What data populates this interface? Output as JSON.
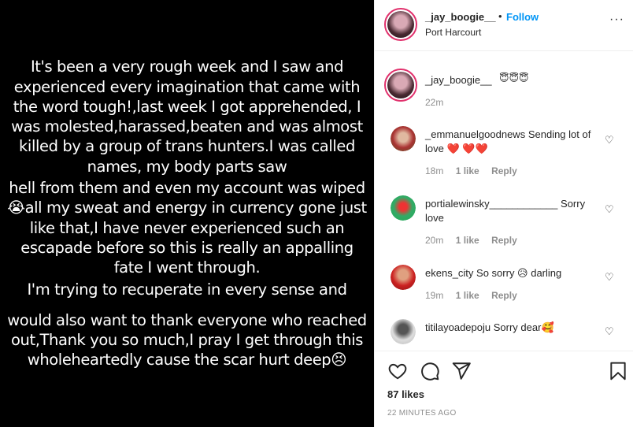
{
  "post_text": [
    "It's been a very rough week and I saw and experienced every imagination that came with the word tough!,last week I got apprehended, I was molested,harassed,beaten and was almost killed by a group of trans hunters.I was called names, my body parts saw",
    "hell from them and even my account was wiped😭all my sweat and energy in currency gone just like that,I have never experienced such an escapade before so this is really an appalling fate I went through.",
    "I'm trying to recuperate in every sense and",
    "would also want to thank everyone who reached out,Thank you so much,I pray I get through this wholeheartedly cause the scar hurt deep😣"
  ],
  "header": {
    "username": "_jay_boogie__",
    "dot": "•",
    "follow_label": "Follow",
    "location": "Port Harcourt",
    "more_label": "···",
    "avatar_icon": "profile-photo"
  },
  "caption": {
    "username": "_jay_boogie__",
    "emoji": "😇😇😇",
    "time": "22m"
  },
  "comments": [
    {
      "username": "_emmanuelgoodnews",
      "text": "Sending lot of love ❤️ ❤️❤️",
      "time": "18m",
      "likes": "1 like",
      "reply": "Reply",
      "avatar_color": "#a33"
    },
    {
      "username": "portialewinsky____________",
      "text": "Sorry love",
      "time": "20m",
      "likes": "1 like",
      "reply": "Reply",
      "avatar_color": "#3a6"
    },
    {
      "username": "ekens_city",
      "text": "So sorry 😥 darling",
      "time": "19m",
      "likes": "1 like",
      "reply": "Reply",
      "avatar_color": "#b22"
    },
    {
      "username": "titilayoadepoju",
      "text": "Sorry dear🥰",
      "time": "",
      "likes": "",
      "reply": "",
      "avatar_color": "#ccc"
    }
  ],
  "actions": {
    "like_icon": "heart-icon",
    "comment_icon": "comment-icon",
    "share_icon": "share-icon",
    "save_icon": "bookmark-icon"
  },
  "likes_text": "87 likes",
  "timestamp": "22 MINUTES AGO",
  "colors": {
    "accent": "#0095f6",
    "story_ring": "#e1306c",
    "muted": "#8e8e8e"
  }
}
